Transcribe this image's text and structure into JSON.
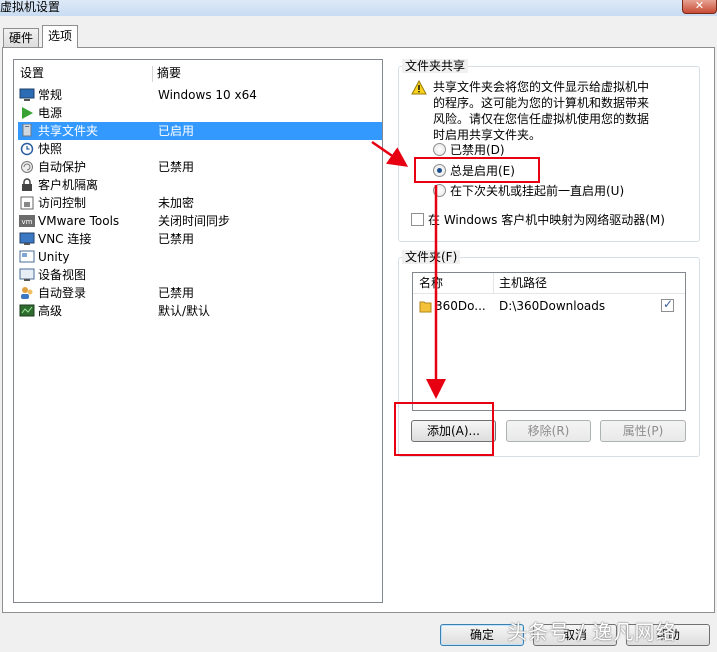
{
  "window": {
    "title": "虚拟机设置"
  },
  "tabs": [
    {
      "label": "硬件"
    },
    {
      "label": "选项"
    }
  ],
  "settings_list": {
    "header_setting": "设置",
    "header_summary": "摘要",
    "items": [
      {
        "label": "常规",
        "summary": "Windows 10 x64"
      },
      {
        "label": "电源",
        "summary": ""
      },
      {
        "label": "共享文件夹",
        "summary": "已启用"
      },
      {
        "label": "快照",
        "summary": ""
      },
      {
        "label": "自动保护",
        "summary": "已禁用"
      },
      {
        "label": "客户机隔离",
        "summary": ""
      },
      {
        "label": "访问控制",
        "summary": "未加密"
      },
      {
        "label": "VMware Tools",
        "summary": "关闭时间同步"
      },
      {
        "label": "VNC 连接",
        "summary": "已禁用"
      },
      {
        "label": "Unity",
        "summary": ""
      },
      {
        "label": "设备视图",
        "summary": ""
      },
      {
        "label": "自动登录",
        "summary": "已禁用"
      },
      {
        "label": "高级",
        "summary": "默认/默认"
      }
    ]
  },
  "folder_sharing": {
    "group_title": "文件夹共享",
    "warning_line1": "共享文件夹会将您的文件显示给虚拟机中",
    "warning_line2": "的程序。这可能为您的计算机和数据带来",
    "warning_line3": "风险。请仅在您信任虚拟机使用您的数据",
    "warning_line4": "时启用共享文件夹。",
    "option_disabled": "已禁用(D)",
    "option_always": "总是启用(E)",
    "option_until_poweroff": "在下次关机或挂起前一直启用(U)",
    "map_drive_label": "在 Windows 客户机中映射为网络驱动器(M)"
  },
  "folders": {
    "group_title": "文件夹(F)",
    "col_name": "名称",
    "col_path": "主机路径",
    "rows": [
      {
        "name": "360Do...",
        "path": "D:\\360Downloads"
      }
    ],
    "add_button": "添加(A)...",
    "remove_button": "移除(R)",
    "properties_button": "属性(P)"
  },
  "footer": {
    "ok_button": "确定",
    "cancel_button": "取消",
    "help_button": "帮助"
  },
  "watermark": "头条号 / 逸凡网络",
  "colors": {
    "selection": "#3399ff",
    "annotation_red": "#e60012"
  }
}
